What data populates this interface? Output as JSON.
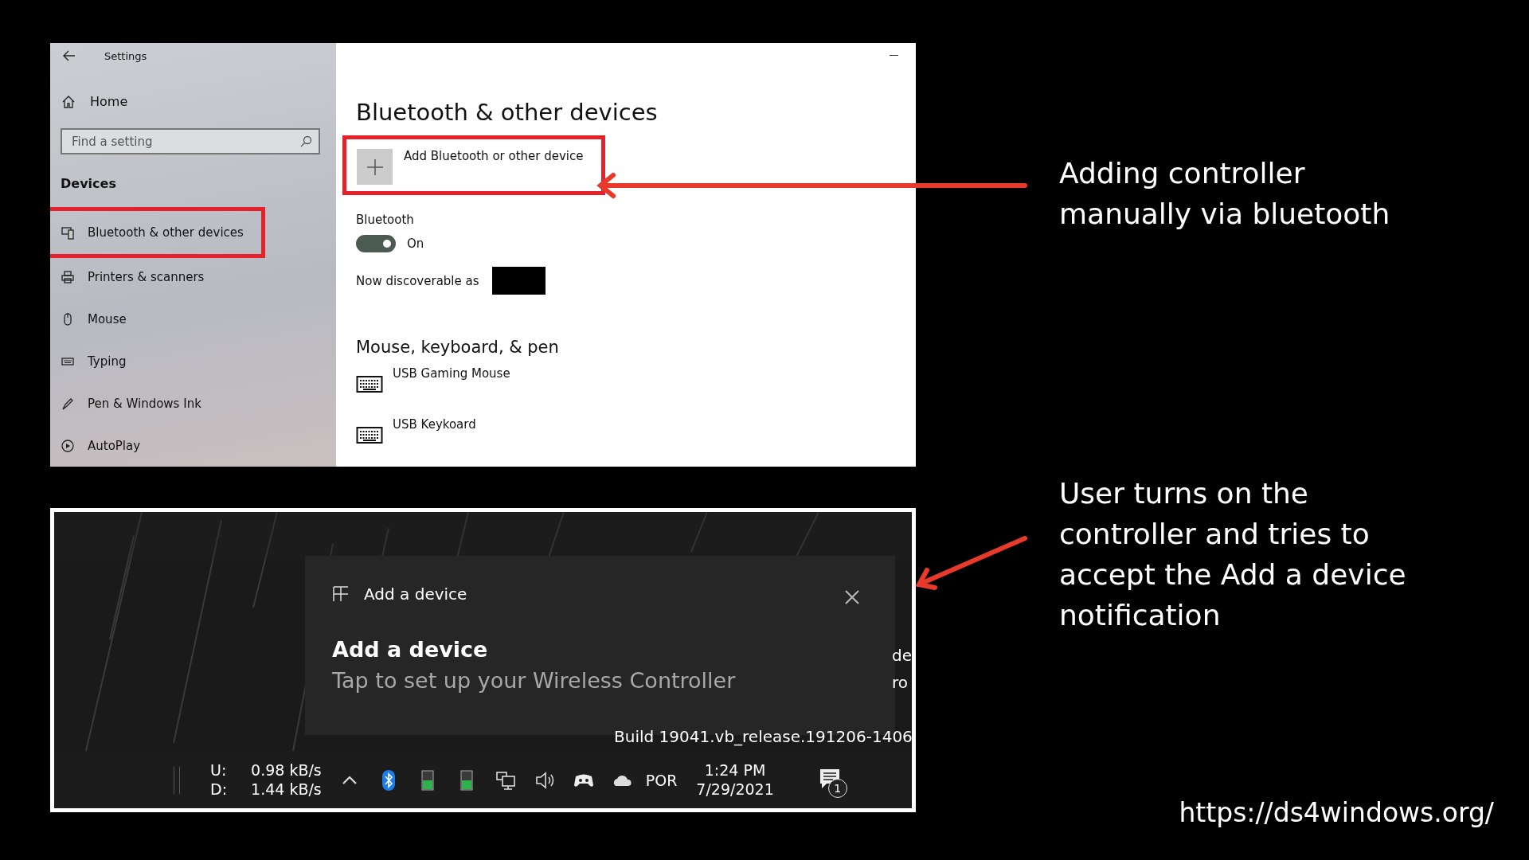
{
  "settings_window": {
    "title": "Settings",
    "home": "Home",
    "search": {
      "placeholder": "Find a setting"
    },
    "section": "Devices",
    "nav": [
      {
        "label": "Bluetooth & other devices",
        "highlighted": true
      },
      {
        "label": "Printers & scanners",
        "highlighted": false
      },
      {
        "label": "Mouse",
        "highlighted": false
      },
      {
        "label": "Typing",
        "highlighted": false
      },
      {
        "label": "Pen & Windows Ink",
        "highlighted": false
      },
      {
        "label": "AutoPlay",
        "highlighted": false
      }
    ],
    "page_title": "Bluetooth & other devices",
    "add_button": {
      "label": "Add Bluetooth or other device",
      "highlighted": true
    },
    "bluetooth": {
      "label": "Bluetooth",
      "on": true,
      "state_text": "On"
    },
    "discoverable_label": "Now discoverable as",
    "group_title": "Mouse, keyboard, & pen",
    "devices": [
      {
        "name": "USB Gaming Mouse"
      },
      {
        "name": "USB Keykoard"
      }
    ]
  },
  "desktop": {
    "notification": {
      "app_title": "Add a device",
      "title": "Add a device",
      "body": "Tap to set up your Wireless Controller"
    },
    "desktop_text": [
      "de",
      "ro",
      "Build 19041.vb_release.191206-1406"
    ],
    "taskbar": {
      "upload_label": "U:",
      "download_label": "D:",
      "upload_rate": "0.98 kB/s",
      "download_rate": "1.44 kB/s",
      "language": "POR",
      "time": "1:24 PM",
      "date": "7/29/2021",
      "notification_count": "1"
    }
  },
  "annotations": [
    {
      "text": "Adding controller manually via bluetooth"
    },
    {
      "text": "User turns on the controller and tries to accept the Add a device notification"
    }
  ],
  "url": "https://ds4windows.org/"
}
